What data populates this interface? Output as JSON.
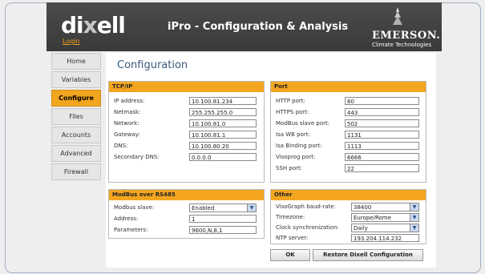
{
  "header": {
    "brand": "dixell",
    "login": "Login",
    "title": "iPro - Configuration & Analysis",
    "partner": "EMERSON.",
    "partner_sub": "Climate Technologies"
  },
  "nav": [
    "Home",
    "Variables",
    "Configure",
    "Files",
    "Accounts",
    "Advanced",
    "Firewall"
  ],
  "active_nav": "Configure",
  "page_title": "Configuration",
  "tcpip": {
    "title": "TCP/IP",
    "rows": [
      {
        "label": "IP address:",
        "value": "10.100.81.234"
      },
      {
        "label": "Netmask:",
        "value": "255.255.255.0"
      },
      {
        "label": "Network:",
        "value": "10.100.81.0"
      },
      {
        "label": "Gateway:",
        "value": "10.100.81.1"
      },
      {
        "label": "DNS:",
        "value": "10.100.80.20"
      },
      {
        "label": "Secondary DNS:",
        "value": "0.0.0.0"
      }
    ]
  },
  "port": {
    "title": "Port",
    "rows": [
      {
        "label": "HTTP port:",
        "value": "80"
      },
      {
        "label": "HTTPS port:",
        "value": "443"
      },
      {
        "label": "ModBus slave port:",
        "value": "502"
      },
      {
        "label": "Isa WB port:",
        "value": "1131"
      },
      {
        "label": "Isa Binding port:",
        "value": "1113"
      },
      {
        "label": "Visoprog port:",
        "value": "6666"
      },
      {
        "label": "SSH port:",
        "value": "22"
      }
    ]
  },
  "modbus": {
    "title": "ModBus over RS485",
    "slave_label": "Modbus slave:",
    "slave_value": "Enabled",
    "address_label": "Address:",
    "address_value": "1",
    "params_label": "Parameters:",
    "params_value": "9600,N,8,1"
  },
  "other": {
    "title": "Other",
    "baud_label": "VisoGraph baud-rate:",
    "baud_value": "38400",
    "tz_label": "Timezone:",
    "tz_value": "Europe/Rome",
    "clock_label": "Clock synchronization:",
    "clock_value": "Daily",
    "ntp_label": "NTP server:",
    "ntp_value": "193.204.114.232"
  },
  "buttons": {
    "ok": "OK",
    "restore": "Restore Dixell Configuration"
  },
  "colors": {
    "accent": "#f4a620",
    "header_bg": "#404040",
    "title_color": "#3a5a7c"
  }
}
